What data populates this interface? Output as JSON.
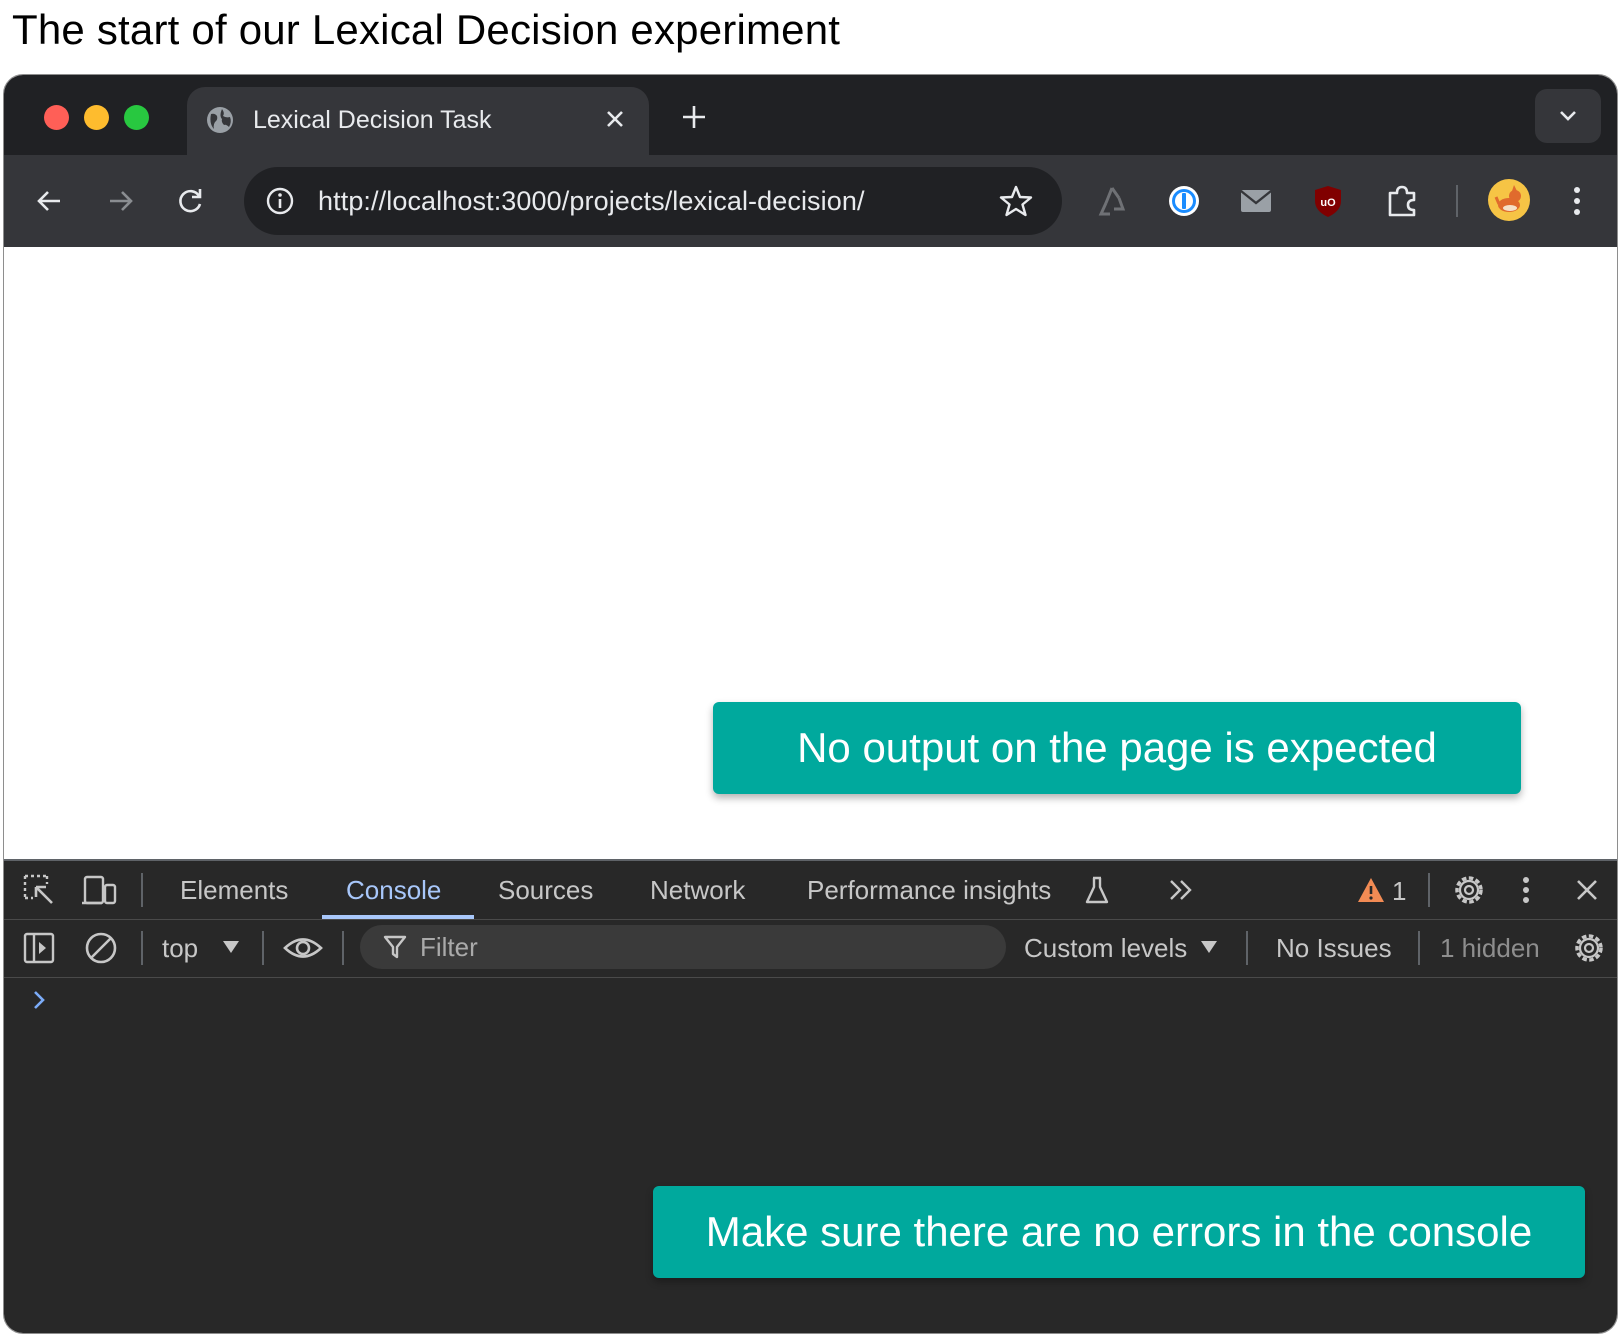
{
  "caption": "The start of our Lexical Decision experiment",
  "browser": {
    "tab_title": "Lexical Decision Task",
    "url": "http://localhost:3000/projects/lexical-decision/"
  },
  "callouts": {
    "page": "No output on the page is expected",
    "console": "Make sure there are no errors in the console"
  },
  "devtools": {
    "tabs": [
      "Elements",
      "Console",
      "Sources",
      "Network",
      "Performance insights"
    ],
    "active_tab": "Console",
    "warning_count": "1",
    "context": "top",
    "filter_placeholder": "Filter",
    "levels": "Custom levels",
    "issues": "No Issues",
    "hidden": "1 hidden"
  },
  "colors": {
    "accent": "#00a99d",
    "active_tab": "#a8c7fa"
  }
}
